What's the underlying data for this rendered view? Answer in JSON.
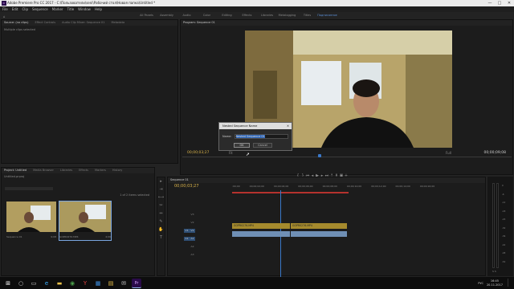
{
  "window": {
    "title": "Adobe Premiere Pro CC 2017 - C:\\Пользователи\\seni\\Рабочий стол\\Новая папка\\Untitled *",
    "controls": {
      "minimize": "—",
      "maximize": "□",
      "close": "✕"
    }
  },
  "menu": [
    "File",
    "Edit",
    "Clip",
    "Sequence",
    "Marker",
    "Title",
    "Window",
    "Help"
  ],
  "workspaces": [
    {
      "label": "All Panels",
      "active": false
    },
    {
      "label": "Assembly",
      "active": false
    },
    {
      "label": "Audio",
      "active": false
    },
    {
      "label": "Color",
      "active": false
    },
    {
      "label": "Editing",
      "active": false
    },
    {
      "label": "Effects",
      "active": false
    },
    {
      "label": "Libraries",
      "active": false
    },
    {
      "label": "Metalogging",
      "active": false
    },
    {
      "label": "Titles",
      "active": false
    },
    {
      "label": "Подписанное",
      "active": true
    }
  ],
  "source_panel": {
    "tabs": [
      "Source: (no clips)",
      "Effect Controls",
      "Audio Clip Mixer: Sequence 01",
      "Metadata"
    ],
    "message": "Multiple clips selected"
  },
  "program": {
    "tab": "Program: Sequence 01",
    "timecode_left": "00;00;03;27",
    "timecode_right": "00;00;09;08",
    "zoom": "Fit",
    "quality": "Full"
  },
  "project": {
    "tabs": [
      "Project: Untitled",
      "Media Browser",
      "Libraries",
      "Effects",
      "Markers",
      "History"
    ],
    "file": "Untitled.prproj",
    "selection": "1 of 2 items selected",
    "items": [
      {
        "name": "Sequence 01",
        "duration": "9;08"
      },
      {
        "name": "GOPR0276.MP4",
        "duration": "4;06"
      }
    ]
  },
  "timeline": {
    "tab": "Sequence 01",
    "timecode": "00;00;03;27",
    "ruler": [
      ":00;00",
      "00;00;02;00",
      "00;00;04;00",
      "00;00;06;00",
      "00;00;08;00",
      "00;00;10;00",
      "00;00;12;00",
      "00;00;14;00",
      "00;00;16;00"
    ],
    "tracks": [
      "V3",
      "V2",
      "V1",
      "A1",
      "A2",
      "A3"
    ],
    "clips": {
      "video": [
        "GOPR0276.MP4",
        "GOPR0276.MP4"
      ],
      "audio": [
        "",
        ""
      ]
    },
    "meter_labels": [
      "0",
      "-6",
      "-12",
      "-18",
      "-24",
      "-30",
      "-36",
      "-42",
      "-48",
      "-54"
    ],
    "meter_footer": "S S"
  },
  "dialog": {
    "title": "Nested Sequence Name",
    "name_label": "Name:",
    "name_value": "Nested Sequence 01",
    "ok": "OK",
    "cancel": "Cancel"
  },
  "taskbar": {
    "icons": [
      "windows-icon",
      "search-icon",
      "task-view-icon",
      "chrome-icon",
      "folder-icon",
      "edge-icon",
      "yandex-icon",
      "store-icon",
      "explorer-icon",
      "mail-icon",
      "premiere-icon"
    ],
    "lang": "РУС",
    "time": "16:45",
    "date": "20.11.2017"
  }
}
